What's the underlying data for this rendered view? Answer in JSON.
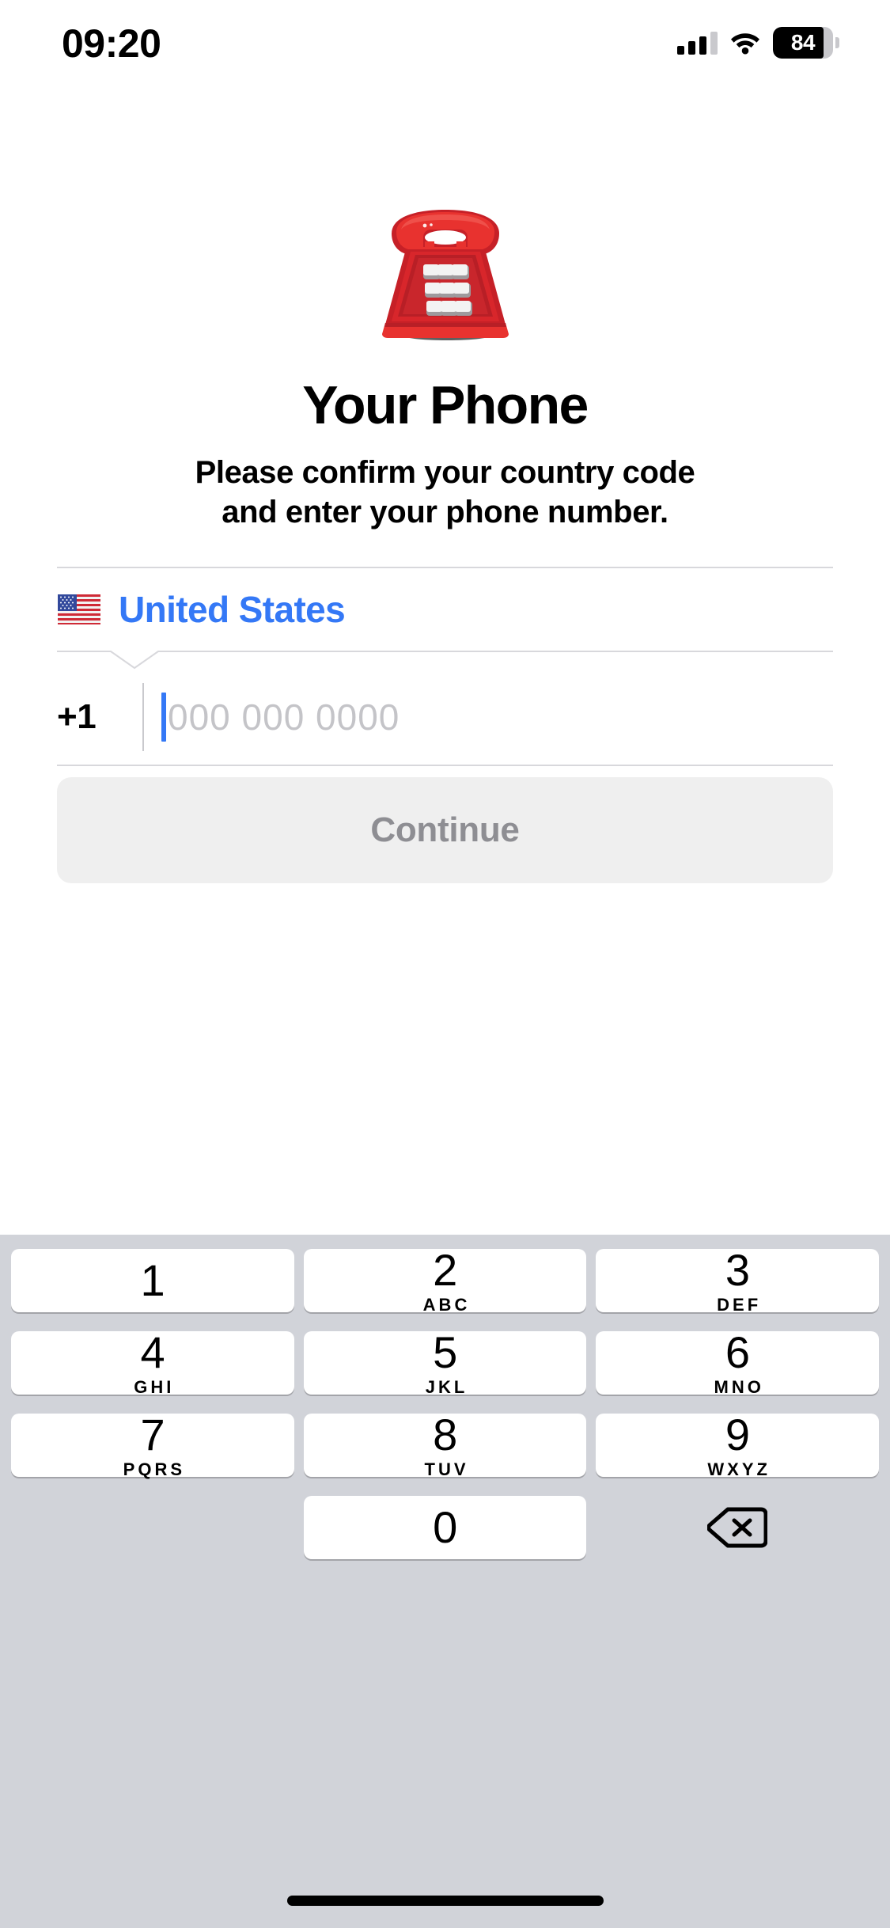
{
  "status_bar": {
    "time": "09:20",
    "cellular_icon": "cellular-signal-icon",
    "wifi_icon": "wifi-icon",
    "battery_icon": "battery-icon",
    "battery_percent": "84",
    "battery_level": 84
  },
  "hero": {
    "icon": "telephone-emoji",
    "emoji": "☎️"
  },
  "header": {
    "title": "Your Phone",
    "subtitle_line1": "Please confirm your country code",
    "subtitle_line2": "and enter your phone number."
  },
  "form": {
    "country": {
      "flag_icon": "us-flag-emoji",
      "flag_emoji": "🇺🇸",
      "name": "United States"
    },
    "phone": {
      "dial_code": "+1",
      "value": "",
      "placeholder": "000 000 0000"
    }
  },
  "continue_button": {
    "label": "Continue",
    "enabled": false
  },
  "keypad": {
    "rows": [
      [
        {
          "digit": "1",
          "letters": ""
        },
        {
          "digit": "2",
          "letters": "ABC"
        },
        {
          "digit": "3",
          "letters": "DEF"
        }
      ],
      [
        {
          "digit": "4",
          "letters": "GHI"
        },
        {
          "digit": "5",
          "letters": "JKL"
        },
        {
          "digit": "6",
          "letters": "MNO"
        }
      ],
      [
        {
          "digit": "7",
          "letters": "PQRS"
        },
        {
          "digit": "8",
          "letters": "TUV"
        },
        {
          "digit": "9",
          "letters": "WXYZ"
        }
      ],
      [
        {
          "digit": "",
          "letters": ""
        },
        {
          "digit": "0",
          "letters": ""
        },
        {
          "digit": "",
          "letters": "",
          "icon": "backspace-icon"
        }
      ]
    ]
  },
  "colors": {
    "accent_blue": "#3478F6",
    "keypad_background": "#D1D3D9",
    "key_white": "#FFFFFF",
    "button_disabled_bg": "#EFEFEF",
    "button_disabled_text": "#8E8E93",
    "placeholder_grey": "#C4C4C8",
    "divider_grey": "#D8D8DC"
  },
  "home_indicator": "home-indicator"
}
